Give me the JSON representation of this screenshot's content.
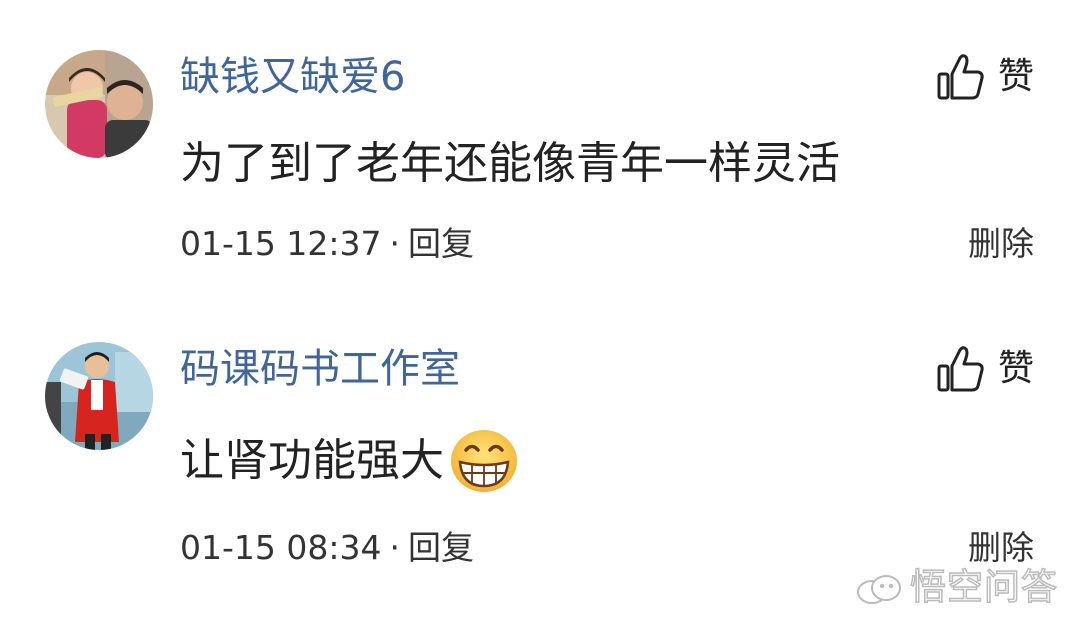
{
  "comments": [
    {
      "avatar_icon": "user-avatar-photo",
      "username": "缺钱又缺爱6",
      "text": "为了到了老年还能像青年一样灵活",
      "time": "01-15 12:37",
      "separator": "·",
      "reply_label": "回复",
      "like_label": "赞",
      "delete_label": "删除"
    },
    {
      "avatar_icon": "user-avatar-photo",
      "username": "码课码书工作室",
      "text": "让肾功能强大",
      "emoji": "grinning-face-emoji",
      "time": "01-15 08:34",
      "separator": "·",
      "reply_label": "回复",
      "like_label": "赞",
      "delete_label": "删除"
    }
  ],
  "watermark": {
    "icon": "wukong-logo-icon",
    "text": "悟空问答"
  },
  "colors": {
    "username": "#406599",
    "text": "#222222",
    "meta": "#333333"
  }
}
